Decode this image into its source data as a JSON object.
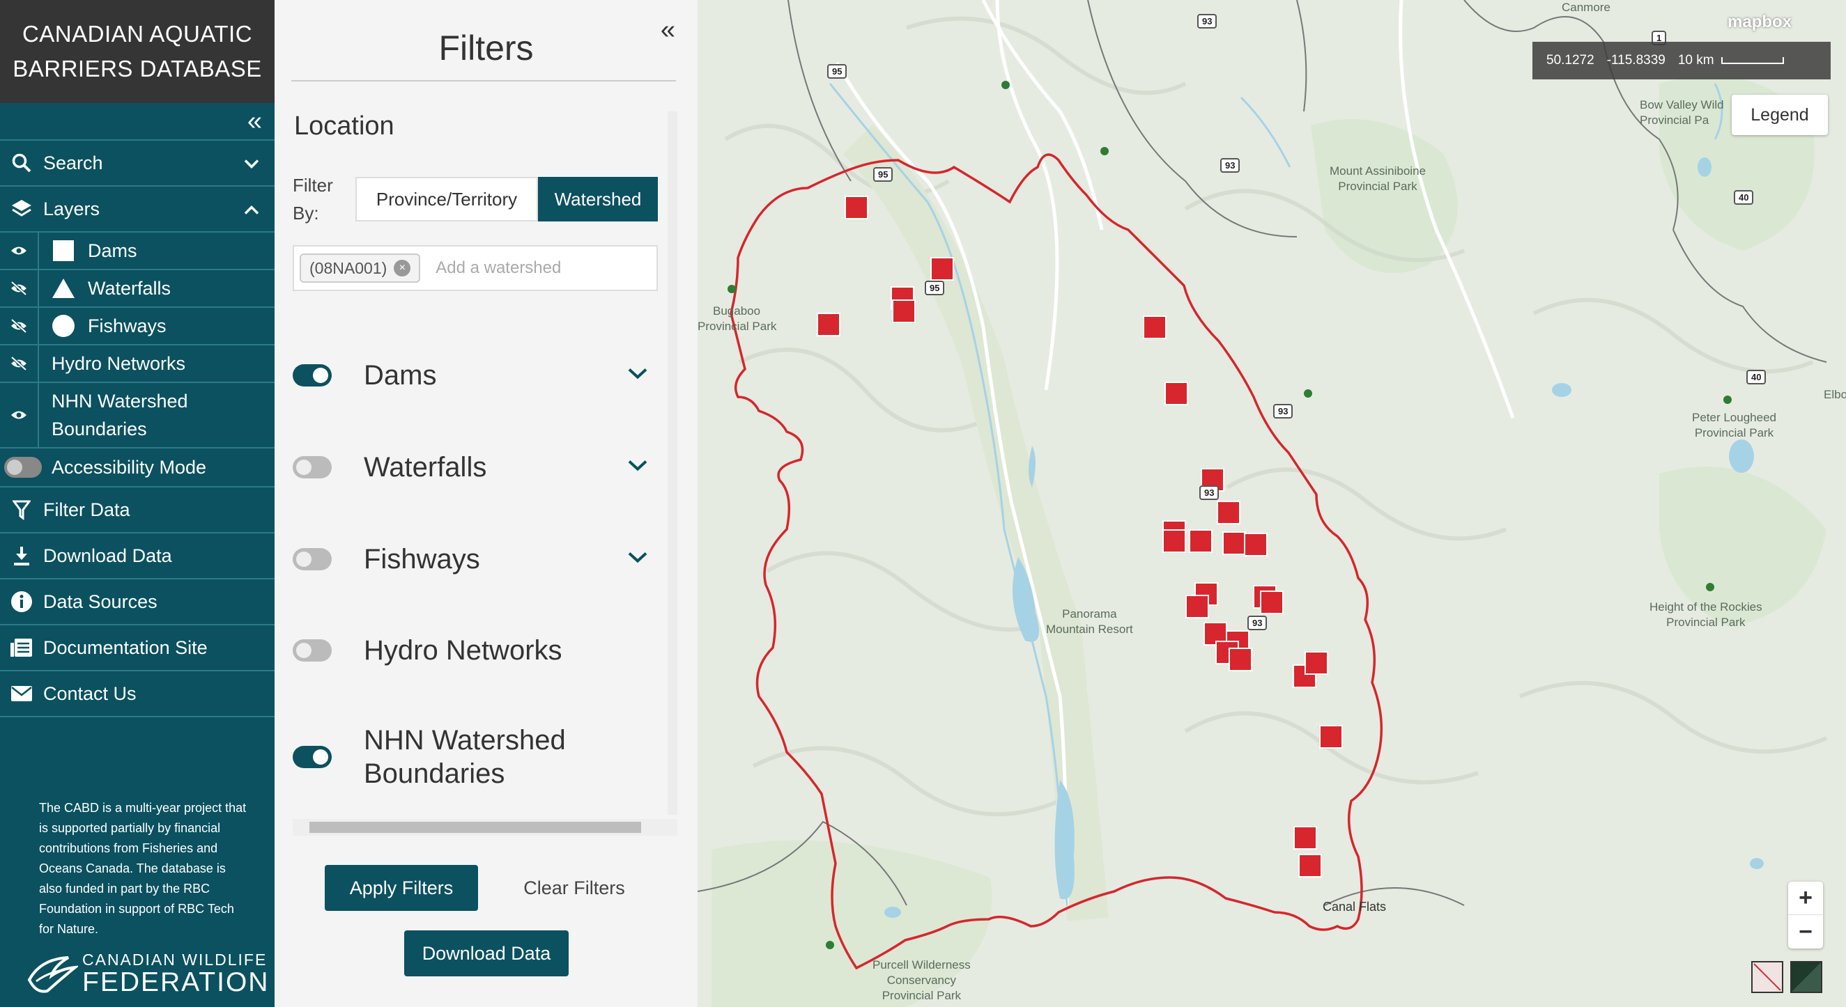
{
  "app": {
    "title_line1": "CANADIAN AQUATIC",
    "title_line2": "BARRIERS DATABASE"
  },
  "sidebar": {
    "collapse_icon": "double-chevron-left-icon",
    "search": "Search",
    "layers": "Layers",
    "layer_items": [
      {
        "label": "Dams",
        "symbol": "square"
      },
      {
        "label": "Waterfalls",
        "symbol": "triangle"
      },
      {
        "label": "Fishways",
        "symbol": "circle"
      },
      {
        "label": "Hydro Networks"
      },
      {
        "label": "NHN Watershed Boundaries"
      }
    ],
    "accessibility": "Accessibility Mode",
    "filter_data": "Filter Data",
    "download_data": "Download Data",
    "data_sources": "Data Sources",
    "documentation": "Documentation Site",
    "contact": "Contact Us",
    "about": "The CABD is a multi-year project that is supported partially by financial contributions from Fisheries and Oceans Canada. The database is also funded in part by the RBC Foundation in support of RBC Tech for Nature.",
    "logo_line1": "CANADIAN WILDLIFE",
    "logo_line2": "FEDERATION"
  },
  "filters": {
    "title": "Filters",
    "location_heading": "Location",
    "filter_by_line1": "Filter",
    "filter_by_line2": "By:",
    "tab_province": "Province/Territory",
    "tab_watershed": "Watershed",
    "selected_watershed": "(08NA001)",
    "watershed_placeholder": "Add a watershed",
    "toggles": [
      {
        "label": "Dams",
        "on": true,
        "expandable": true
      },
      {
        "label": "Waterfalls",
        "on": false,
        "expandable": true
      },
      {
        "label": "Fishways",
        "on": false,
        "expandable": true
      },
      {
        "label": "Hydro Networks",
        "on": false,
        "expandable": false
      },
      {
        "label": "NHN Watershed Boundaries",
        "on": true,
        "expandable": false
      }
    ],
    "nhn_line1": "NHN Watershed",
    "nhn_line2": "Boundaries",
    "apply": "Apply Filters",
    "clear": "Clear Filters",
    "download": "Download Data"
  },
  "map": {
    "latitude": "50.1272",
    "longitude": "-115.8339",
    "scale": "10 km",
    "attribution_logo": "mapbox",
    "legend": "Legend",
    "zoom_in": "+",
    "zoom_out": "−",
    "labels": {
      "canmore": "Canmore",
      "bow_valley": "Bow Valley Wild",
      "bow_valley2": "Provincial Pa",
      "assiniboine1": "Mount Assiniboine",
      "assiniboine2": "Provincial Park",
      "bugaboo1": "Bugaboo",
      "bugaboo2": "Provincial Park",
      "peter1": "Peter Lougheed",
      "peter2": "Provincial Park",
      "panorama1": "Panorama",
      "panorama2": "Mountain Resort",
      "rockies1": "Height of the Rockies",
      "rockies2": "Provincial Park",
      "purcell1": "Purcell Wilderness",
      "purcell2": "Conservancy",
      "purcell3": "Provincial Park",
      "canal_flats": "Canal Flats",
      "elbow": "Elbo"
    },
    "shields": [
      "93",
      "95",
      "95",
      "93",
      "95",
      "93",
      "93",
      "93",
      "1",
      "40",
      "40"
    ],
    "colors": {
      "boundary": "#d7262d",
      "dam_marker": "#d7262d",
      "water": "#a6d2e6",
      "land": "#e8ede4",
      "park": "#d6e6cf"
    }
  }
}
